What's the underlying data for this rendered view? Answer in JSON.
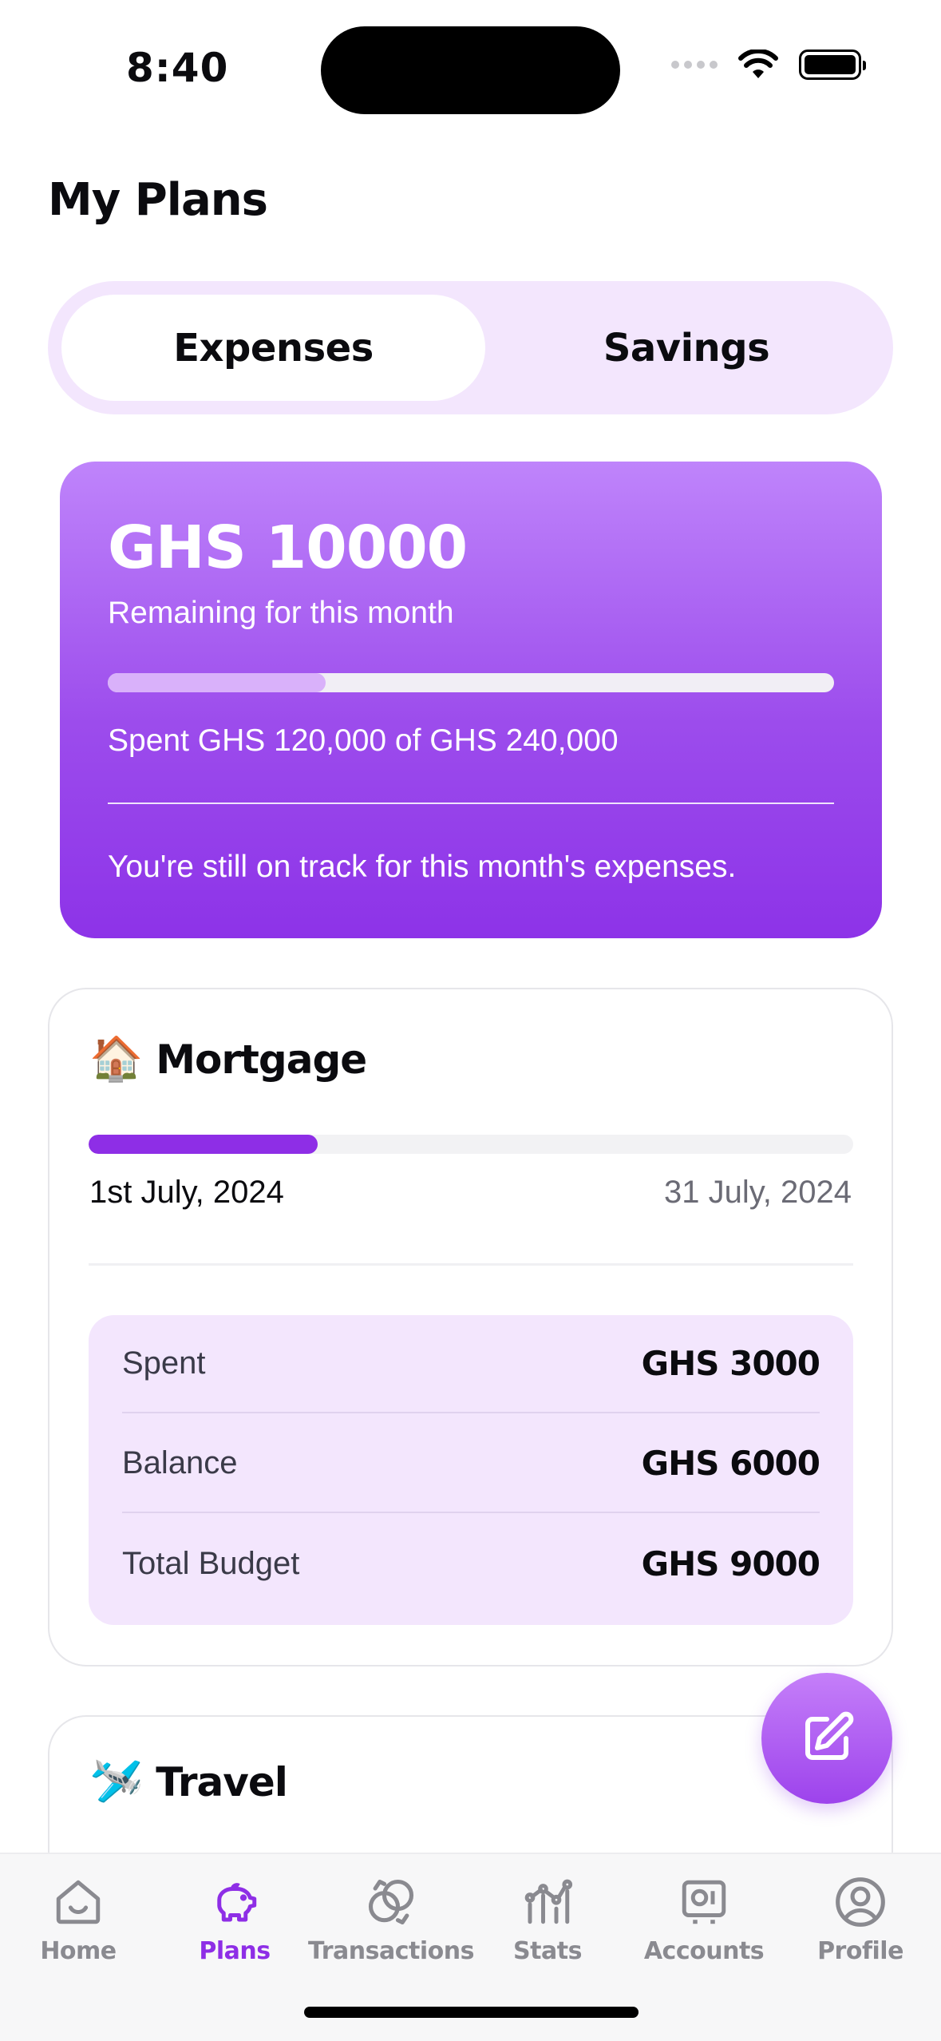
{
  "status": {
    "time": "8:40"
  },
  "page": {
    "title": "My Plans"
  },
  "segments": {
    "expenses": "Expenses",
    "savings": "Savings",
    "active": "Expenses"
  },
  "summary": {
    "amount": "GHS 10000",
    "remaining_label": "Remaining for this month",
    "progress": 0.3,
    "spent_text": "Spent GHS 120,000 of GHS 240,000",
    "track_text": "You're still on track for this month's expenses."
  },
  "plans": [
    {
      "emoji": "🏠",
      "name": "Mortgage",
      "progress": 0.3,
      "start_date": "1st July, 2024",
      "end_date": "31 July, 2024",
      "rows": [
        {
          "label": "Spent",
          "value": "GHS 3000"
        },
        {
          "label": "Balance",
          "value": "GHS 6000"
        },
        {
          "label": "Total Budget",
          "value": "GHS 9000"
        }
      ]
    },
    {
      "emoji": "🛩️",
      "name": "Travel"
    }
  ],
  "fab": {
    "icon": "edit-icon"
  },
  "tabbar": {
    "items": [
      {
        "label": "Home",
        "icon": "home-icon"
      },
      {
        "label": "Plans",
        "icon": "piggy-bank-icon",
        "active": true
      },
      {
        "label": "Transactions",
        "icon": "transactions-icon"
      },
      {
        "label": "Stats",
        "icon": "stats-icon"
      },
      {
        "label": "Accounts",
        "icon": "accounts-icon"
      },
      {
        "label": "Profile",
        "icon": "profile-icon"
      }
    ]
  },
  "colors": {
    "accent": "#8e2ee6",
    "accent_light": "#f3e6fd",
    "card_gradient_top": "#bf84fb",
    "card_gradient_bottom": "#8d33e8"
  }
}
